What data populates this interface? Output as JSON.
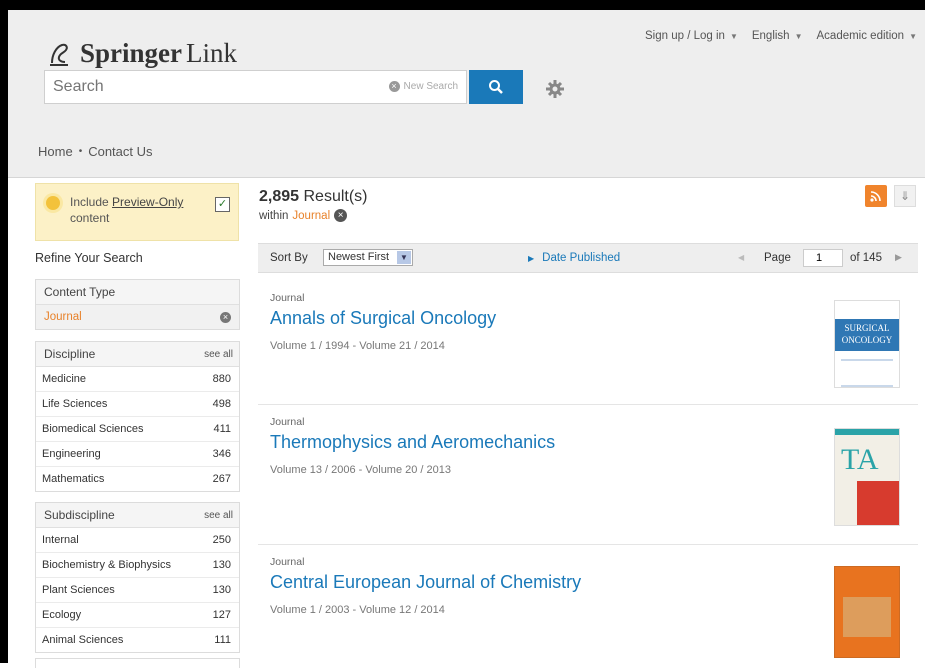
{
  "header": {
    "logo_word1": "Springer",
    "logo_word2": "Link",
    "topnav": [
      "Sign up / Log in",
      "English",
      "Academic edition"
    ],
    "search_placeholder": "Search",
    "new_search": "New Search",
    "breadcrumb": [
      "Home",
      "Contact Us"
    ]
  },
  "preview": {
    "text_before": "Include ",
    "link": "Preview-Only",
    "text_after": "content",
    "checked": true
  },
  "refine_title": "Refine Your Search",
  "content_type": {
    "title": "Content Type",
    "selected": "Journal"
  },
  "discipline": {
    "title": "Discipline",
    "see_all": "see all",
    "items": [
      {
        "label": "Medicine",
        "count": "880"
      },
      {
        "label": "Life Sciences",
        "count": "498"
      },
      {
        "label": "Biomedical Sciences",
        "count": "411"
      },
      {
        "label": "Engineering",
        "count": "346"
      },
      {
        "label": "Mathematics",
        "count": "267"
      }
    ]
  },
  "subdiscipline": {
    "title": "Subdiscipline",
    "see_all": "see all",
    "items": [
      {
        "label": "Internal",
        "count": "250"
      },
      {
        "label": "Biochemistry & Biophysics",
        "count": "130"
      },
      {
        "label": "Plant Sciences",
        "count": "130"
      },
      {
        "label": "Ecology",
        "count": "127"
      },
      {
        "label": "Animal Sciences",
        "count": "111"
      }
    ]
  },
  "results": {
    "count": "2,895",
    "count_suffix": " Result(s)",
    "within_label": "within",
    "within_value": "Journal"
  },
  "sortbar": {
    "sort_by": "Sort By",
    "sort_value": "Newest First",
    "date_published": "Date Published",
    "page_label": "Page",
    "page_value": "1",
    "of_pages": "of 145"
  },
  "items": [
    {
      "type": "Journal",
      "title": "Annals of Surgical Oncology",
      "volumes": "Volume 1 / 1994 - Volume 21 / 2014",
      "cover_text": "SURGICAL ONCOLOGY"
    },
    {
      "type": "Journal",
      "title": "Thermophysics and Aeromechanics",
      "volumes": "Volume 13 / 2006 - Volume 20 / 2013",
      "cover_text": "TA"
    },
    {
      "type": "Journal",
      "title": "Central European Journal of Chemistry",
      "volumes": "Volume 1 / 2003 - Volume 12 / 2014",
      "cover_text": ""
    }
  ],
  "colors": {
    "link_blue": "#1a79b9",
    "accent_orange": "#e8822a",
    "rss_orange": "#f0842c",
    "preview_bg": "#fcf1c7"
  }
}
